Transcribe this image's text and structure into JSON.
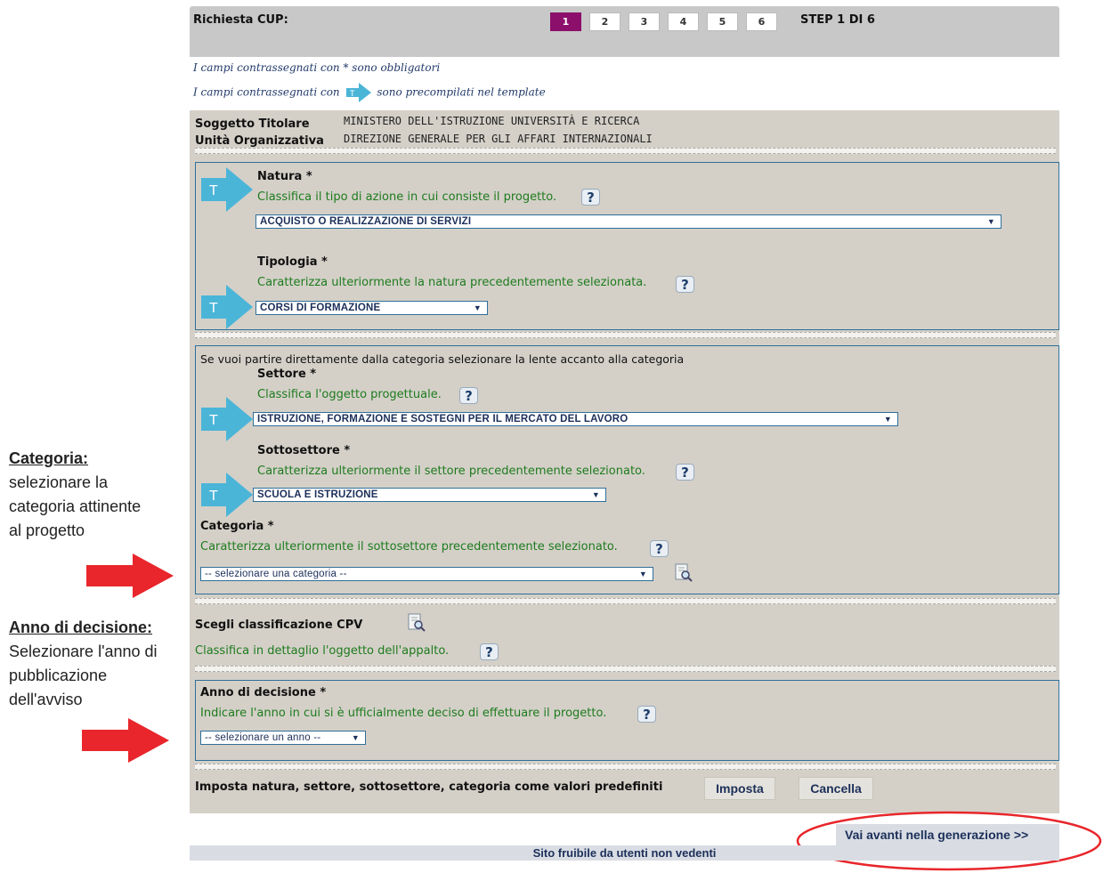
{
  "annotations": {
    "categoria": {
      "heading": "Categoria:",
      "lines": [
        "selezionare la",
        "categoria attinente",
        "al progetto"
      ]
    },
    "anno": {
      "heading": "Anno di decisione:",
      "lines": [
        "Selezionare l'anno di",
        "pubblicazione",
        "dell'avviso"
      ]
    }
  },
  "header": {
    "title": "Richiesta CUP:",
    "steps": [
      "1",
      "2",
      "3",
      "4",
      "5",
      "6"
    ],
    "active_step": "1",
    "step_of": "STEP 1 DI 6"
  },
  "notes": {
    "required": "I campi contrassegnati con * sono obbligatori",
    "template_before": "I campi contrassegnati con",
    "template_after": "sono precompilati nel template",
    "badge": "T"
  },
  "soggetto": {
    "titolare_label": "Soggetto Titolare",
    "titolare_value": "MINISTERO DELL'ISTRUZIONE UNIVERSITÀ E RICERCA",
    "unita_label": "Unità Organizzativa",
    "unita_value": "DIREZIONE GENERALE PER GLI AFFARI INTERNAZIONALI"
  },
  "natura": {
    "label": "Natura *",
    "help_text": "Classifica il tipo di azione in cui consiste il progetto.",
    "value": "ACQUISTO O REALIZZAZIONE DI SERVIZI"
  },
  "tipologia": {
    "label": "Tipologia *",
    "help_text": "Caratterizza ulteriormente la natura precedentemente selezionata.",
    "value": "CORSI DI FORMAZIONE"
  },
  "categoria_hint": "Se vuoi partire direttamente dalla categoria selezionare la lente accanto alla categoria",
  "settore": {
    "label": "Settore *",
    "help_text": "Classifica l'oggetto progettuale.",
    "value": "ISTRUZIONE, FORMAZIONE E SOSTEGNI PER IL MERCATO DEL LAVORO"
  },
  "sottosettore": {
    "label": "Sottosettore *",
    "help_text": "Caratterizza ulteriormente il settore precedentemente selezionato.",
    "value": "SCUOLA E ISTRUZIONE"
  },
  "categoria": {
    "label": "Categoria *",
    "help_text": "Caratterizza ulteriormente il sottosettore precedentemente selezionato.",
    "value": "-- selezionare una categoria --"
  },
  "cpv": {
    "label": "Scegli classificazione CPV",
    "help_text": "Classifica in dettaglio l'oggetto dell'appalto."
  },
  "anno": {
    "label": "Anno di decisione *",
    "help_text": "Indicare l'anno in cui si è ufficialmente deciso di effettuare il progetto.",
    "value": "-- selezionare un anno --"
  },
  "defaults": {
    "label": "Imposta natura, settore, sottosettore, categoria come valori predefiniti",
    "imposta": "Imposta",
    "cancella": "Cancella"
  },
  "help_glyph": "?",
  "next_button": "Vai avanti nella generazione >>",
  "footer": "Sito fruibile da utenti non vedenti",
  "colors": {
    "active_step": "#8b0f6b",
    "panel": "#d4d0c8",
    "help_green": "#1e7b1e",
    "template_arrow": "#4bb5d8",
    "annotation_red": "#e8262b"
  }
}
